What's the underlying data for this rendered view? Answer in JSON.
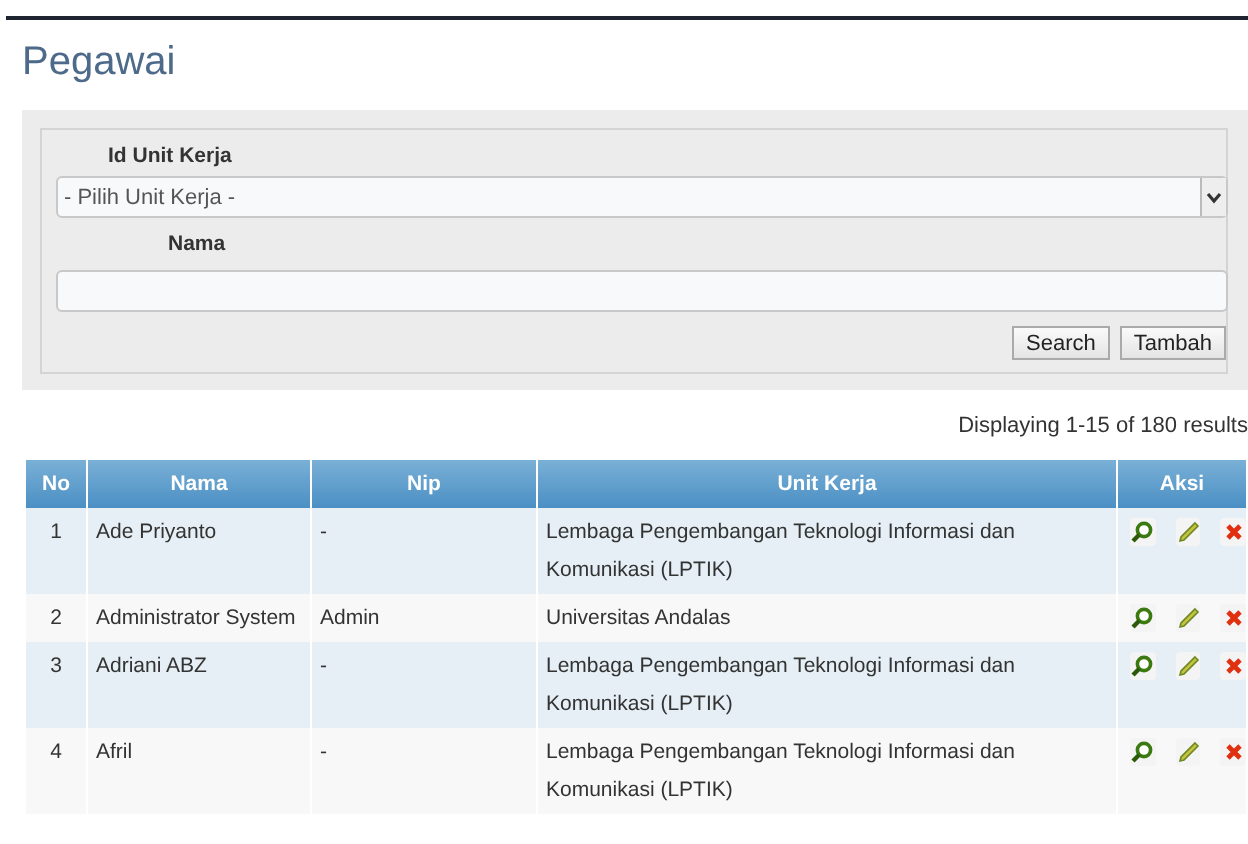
{
  "title": "Pegawai",
  "filter": {
    "unit_label": "Id Unit Kerja",
    "unit_select": "- Pilih Unit Kerja -",
    "name_label": "Nama",
    "buttons": [
      "Search",
      "Tambah"
    ]
  },
  "summary": "Displaying 1-15 of 180 results",
  "table": {
    "columns": [
      "No",
      "Nama",
      "Nip",
      "Unit Kerja",
      "Aksi"
    ],
    "rows": [
      {
        "no": "1",
        "nama": "Ade Priyanto",
        "nip": "-",
        "unit": "Lembaga Pengembangan Teknologi Informasi dan Komunikasi (LPTIK)"
      },
      {
        "no": "2",
        "nama": "Administrator System",
        "nip": "Admin",
        "unit": "Universitas Andalas"
      },
      {
        "no": "3",
        "nama": "Adriani ABZ",
        "nip": "-",
        "unit": "Lembaga Pengembangan Teknologi Informasi dan Komunikasi (LPTIK)"
      },
      {
        "no": "4",
        "nama": "Afril",
        "nip": "-",
        "unit": "Lembaga Pengembangan Teknologi Informasi dan Komunikasi (LPTIK)"
      }
    ]
  }
}
